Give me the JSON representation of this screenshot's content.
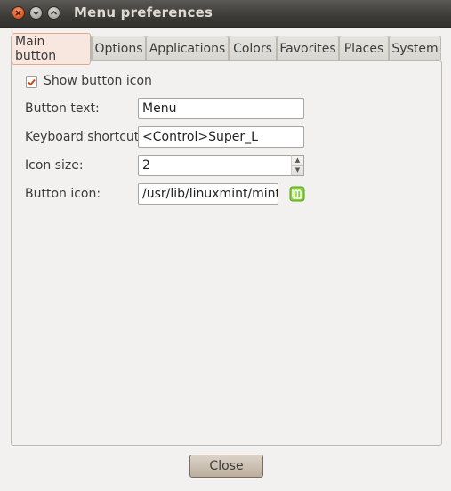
{
  "window": {
    "title": "Menu preferences",
    "close_icon": "close-icon",
    "minimize_icon": "minimize-icon",
    "maximize_icon": "maximize-icon"
  },
  "tabs": [
    {
      "label": "Main button",
      "active": true
    },
    {
      "label": "Options"
    },
    {
      "label": "Applications"
    },
    {
      "label": "Colors"
    },
    {
      "label": "Favorites"
    },
    {
      "label": "Places"
    },
    {
      "label": "System"
    }
  ],
  "main": {
    "show_icon": {
      "label": "Show button icon",
      "checked": true
    },
    "button_text": {
      "label": "Button text:",
      "value": "Menu"
    },
    "shortcut": {
      "label": "Keyboard shortcut:",
      "value": "<Control>Super_L"
    },
    "icon_size": {
      "label": "Icon size:",
      "value": "2"
    },
    "button_icon": {
      "label": "Button icon:",
      "value": "/usr/lib/linuxmint/mintM",
      "icon": "mint-logo-icon"
    }
  },
  "footer": {
    "close_label": "Close"
  },
  "colors": {
    "accent": "#e35c23",
    "titlebar": "#3c3b37",
    "mint": "#87cf3e"
  }
}
